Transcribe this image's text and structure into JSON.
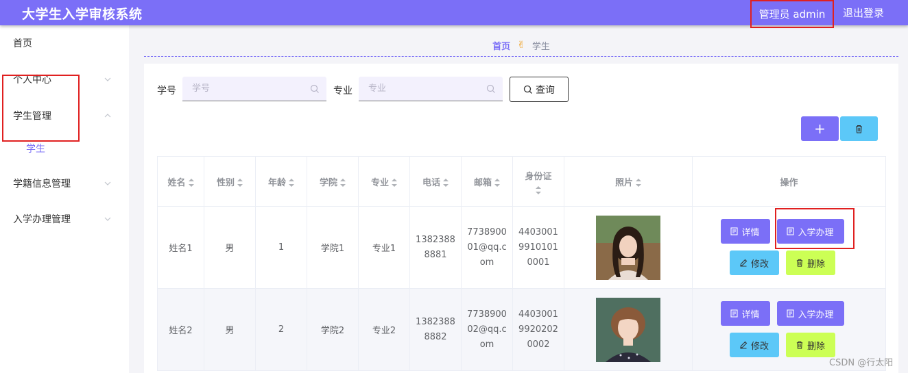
{
  "header": {
    "title": "大学生入学审核系统",
    "admin": "管理员 admin",
    "logout": "退出登录"
  },
  "sidebar": {
    "items": [
      {
        "label": "首页"
      },
      {
        "label": "个人中心"
      },
      {
        "label": "学生管理"
      },
      {
        "label": "学籍信息管理"
      },
      {
        "label": "入学办理管理"
      }
    ],
    "sub_items": [
      {
        "label": "学生"
      }
    ]
  },
  "breadcrumb": {
    "home": "首页",
    "current": "学生"
  },
  "search": {
    "fields": [
      {
        "label": "学号",
        "placeholder": "学号"
      },
      {
        "label": "专业",
        "placeholder": "专业"
      }
    ],
    "query_label": "查询"
  },
  "table": {
    "columns": [
      "姓名",
      "性别",
      "年龄",
      "学院",
      "专业",
      "电话",
      "邮箱",
      "身份证",
      "照片",
      "操作"
    ],
    "rows": [
      {
        "name": "姓名1",
        "gender": "男",
        "age": "1",
        "college": "学院1",
        "major": "专业1",
        "phone": "13823888881",
        "email": "773890001@qq.com",
        "id_card": "440300199101010001"
      },
      {
        "name": "姓名2",
        "gender": "男",
        "age": "2",
        "college": "学院2",
        "major": "专业2",
        "phone": "13823888882",
        "email": "773890002@qq.com",
        "id_card": "440300199202020002"
      }
    ],
    "actions": {
      "detail": "详情",
      "enroll": "入学办理",
      "edit": "修改",
      "delete": "删除"
    }
  },
  "colors": {
    "accent": "#7b6ff7",
    "cyan": "#5cc8f8",
    "lime": "#ccff55",
    "highlight": "#e02020"
  },
  "watermark": "CSDN @行太阳"
}
